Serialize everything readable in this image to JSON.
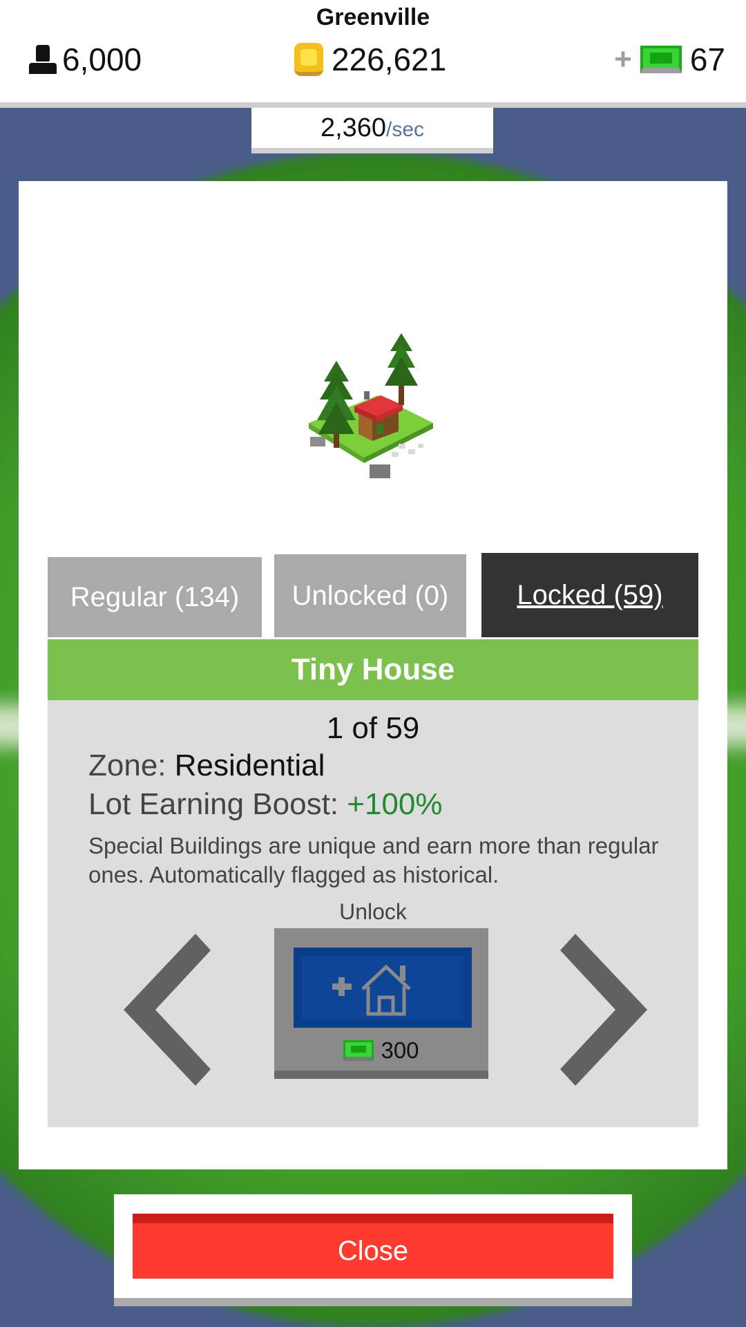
{
  "hud": {
    "city_name": "Greenville",
    "population": "6,000",
    "money": "226,621",
    "cash": "67",
    "rate_value": "2,360",
    "rate_unit": "/sec"
  },
  "tabs": {
    "regular": "Regular (134)",
    "unlocked": "Unlocked (0)",
    "locked": "Locked (59)",
    "active": "locked"
  },
  "building": {
    "name": "Tiny House",
    "counter": "1 of 59",
    "zone_label": "Zone:",
    "zone_value": "Residential",
    "boost_label": "Lot Earning Boost:",
    "boost_value": "+100%",
    "description": "Special Buildings are unique and earn more than regular ones. Automatically flagged as historical."
  },
  "unlock": {
    "label": "Unlock",
    "price": "300"
  },
  "close_label": "Close",
  "icons": [
    "person-icon",
    "coin-icon",
    "plus-icon",
    "cash-bill-icon",
    "add-house-icon",
    "chevron-left-icon",
    "chevron-right-icon"
  ],
  "colors": {
    "title_bar": "#7cc04e",
    "active_tab": "#333333",
    "inactive_tab": "#aaaaaa",
    "boost_green": "#1f8b2c",
    "close_red": "#ff3a2f",
    "unlock_blue": "#0f4597"
  }
}
